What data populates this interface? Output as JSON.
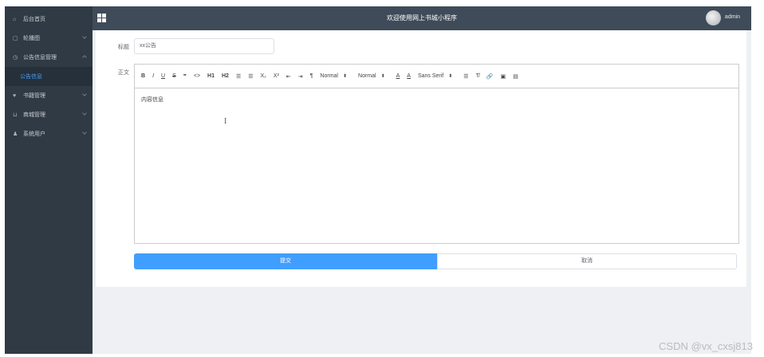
{
  "topbar": {
    "title": "欢迎使用网上书城小程序",
    "user": "admin"
  },
  "sidebar": {
    "items": [
      {
        "icon": "⌂",
        "label": "后台首页",
        "has_children": false
      },
      {
        "icon": "▢",
        "label": "轮播图",
        "has_children": true
      },
      {
        "icon": "◷",
        "label": "公告信息管理",
        "has_children": true,
        "open": true
      },
      {
        "icon": "♥",
        "label": "书籍管理",
        "has_children": true
      },
      {
        "icon": "⊔",
        "label": "商城管理",
        "has_children": true
      },
      {
        "icon": "♟",
        "label": "系统用户",
        "has_children": true
      }
    ],
    "sub_item": "公告信息"
  },
  "form": {
    "title_label": "标题",
    "title_value": "xx公告",
    "content_label": "正文",
    "content_value": "内容信息",
    "submit_label": "提交",
    "cancel_label": "取消"
  },
  "toolbar": {
    "bold": "B",
    "italic": "I",
    "underline": "U",
    "strike": "S",
    "quote": "❞",
    "code": "<>",
    "h1": "H1",
    "h2": "H2",
    "ol": "☰",
    "ul": "☰",
    "sub": "X₂",
    "sup": "X²",
    "indent_less": "⇤",
    "indent_more": "⇥",
    "direction": "¶",
    "size1": "Normal",
    "size2": "Normal",
    "color": "A",
    "bg": "A",
    "font": "Sans Serif",
    "align": "☰",
    "clean": "T̸",
    "link": "🔗",
    "image": "▣",
    "video": "▤"
  },
  "watermark": "CSDN @vx_cxsj813"
}
